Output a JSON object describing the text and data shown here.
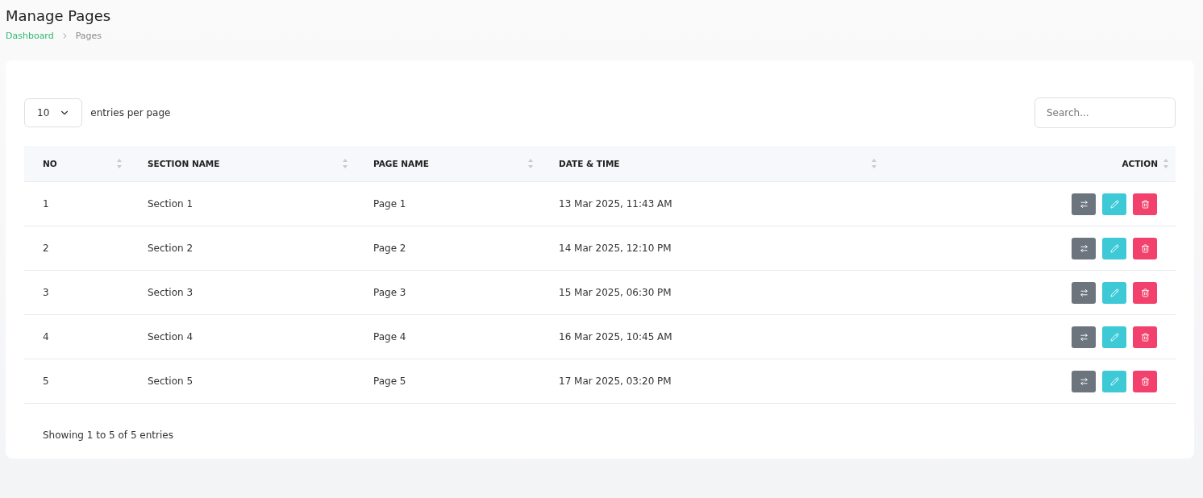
{
  "page": {
    "title": "Manage Pages",
    "breadcrumb": [
      "Dashboard",
      "Pages"
    ]
  },
  "controls": {
    "page_size": "10",
    "page_size_label": "entries per page",
    "search": {
      "placeholder": "Search..."
    }
  },
  "table": {
    "columns": [
      "NO",
      "SECTION NAME",
      "PAGE NAME",
      "DATE & TIME",
      "ACTION"
    ],
    "rows": [
      {
        "no": "1",
        "section": "Section 1",
        "page": "Page 1",
        "datetime": "13 Mar 2025, 11:43 AM"
      },
      {
        "no": "2",
        "section": "Section 2",
        "page": "Page 2",
        "datetime": "14 Mar 2025, 12:10 PM"
      },
      {
        "no": "3",
        "section": "Section 3",
        "page": "Page 3",
        "datetime": "15 Mar 2025, 06:30 PM"
      },
      {
        "no": "4",
        "section": "Section 4",
        "page": "Page 4",
        "datetime": "16 Mar 2025, 10:45 AM"
      },
      {
        "no": "5",
        "section": "Section 5",
        "page": "Page 5",
        "datetime": "17 Mar 2025, 03:20 PM"
      }
    ],
    "actions": [
      {
        "kind": "swap"
      },
      {
        "kind": "edit"
      },
      {
        "kind": "delete"
      }
    ]
  },
  "footer": "Showing 1 to 5 of 5 entries"
}
